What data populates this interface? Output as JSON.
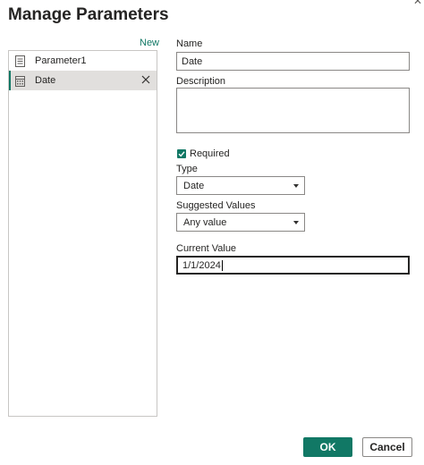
{
  "dialog": {
    "title": "Manage Parameters"
  },
  "sidebar": {
    "new_label": "New",
    "items": [
      {
        "label": "Parameter1",
        "icon": "document-icon",
        "selected": false
      },
      {
        "label": "Date",
        "icon": "calendar-icon",
        "selected": true
      }
    ]
  },
  "form": {
    "name_label": "Name",
    "name_value": "Date",
    "description_label": "Description",
    "description_value": "",
    "required_label": "Required",
    "required_checked": true,
    "type_label": "Type",
    "type_value": "Date",
    "suggested_label": "Suggested Values",
    "suggested_value": "Any value",
    "current_label": "Current Value",
    "current_value": "1/1/2024"
  },
  "footer": {
    "ok_label": "OK",
    "cancel_label": "Cancel"
  },
  "colors": {
    "accent": "#117865",
    "border": "#8a8886",
    "selected_bg": "#e1dfdd"
  }
}
